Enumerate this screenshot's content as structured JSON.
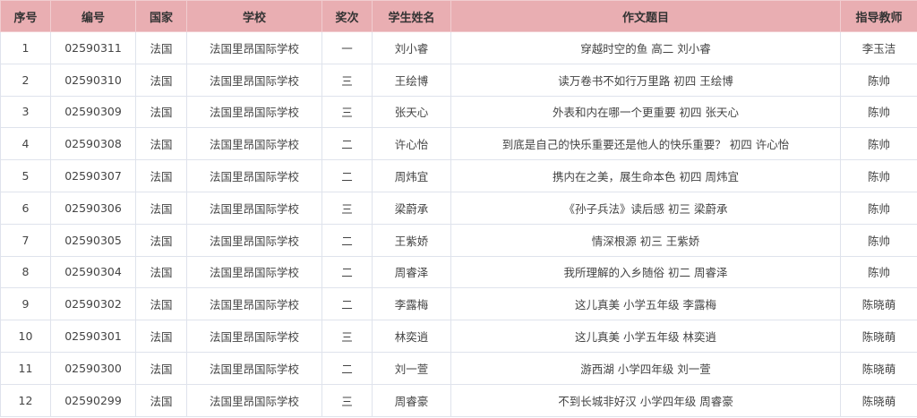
{
  "colors": {
    "header_bg": "#e9aeb2",
    "border": "#dfe3ec",
    "text": "#444444"
  },
  "headers": [
    "序号",
    "编号",
    "国家",
    "学校",
    "奖次",
    "学生姓名",
    "作文题目",
    "指导教师"
  ],
  "rows": [
    [
      "1",
      "02590311",
      "法国",
      "法国里昂国际学校",
      "一",
      "刘小睿",
      "穿越时空的鱼 高二 刘小睿",
      "李玉洁"
    ],
    [
      "2",
      "02590310",
      "法国",
      "法国里昂国际学校",
      "三",
      "王绘博",
      "读万卷书不如行万里路 初四 王绘博",
      "陈帅"
    ],
    [
      "3",
      "02590309",
      "法国",
      "法国里昂国际学校",
      "三",
      "张天心",
      "外表和内在哪一个更重要 初四 张天心",
      "陈帅"
    ],
    [
      "4",
      "02590308",
      "法国",
      "法国里昂国际学校",
      "二",
      "许心怡",
      "到底是自己的快乐重要还是他人的快乐重要？ 初四 许心怡",
      "陈帅"
    ],
    [
      "5",
      "02590307",
      "法国",
      "法国里昂国际学校",
      "二",
      "周炜宜",
      "携内在之美，展生命本色 初四 周炜宜",
      "陈帅"
    ],
    [
      "6",
      "02590306",
      "法国",
      "法国里昂国际学校",
      "三",
      "梁蔚承",
      "《孙子兵法》读后感 初三 梁蔚承",
      "陈帅"
    ],
    [
      "7",
      "02590305",
      "法国",
      "法国里昂国际学校",
      "二",
      "王紫娇",
      "情深根源 初三 王紫娇",
      "陈帅"
    ],
    [
      "8",
      "02590304",
      "法国",
      "法国里昂国际学校",
      "二",
      "周睿泽",
      "我所理解的入乡随俗 初二 周睿泽",
      "陈帅"
    ],
    [
      "9",
      "02590302",
      "法国",
      "法国里昂国际学校",
      "二",
      "李露梅",
      "这儿真美 小学五年级 李露梅",
      "陈晓萌"
    ],
    [
      "10",
      "02590301",
      "法国",
      "法国里昂国际学校",
      "三",
      "林奕逍",
      "这儿真美 小学五年级 林奕逍",
      "陈晓萌"
    ],
    [
      "11",
      "02590300",
      "法国",
      "法国里昂国际学校",
      "二",
      "刘一萱",
      "游西湖 小学四年级 刘一萱",
      "陈晓萌"
    ],
    [
      "12",
      "02590299",
      "法国",
      "法国里昂国际学校",
      "三",
      "周睿豪",
      "不到长城非好汉 小学四年级 周睿豪",
      "陈晓萌"
    ]
  ]
}
